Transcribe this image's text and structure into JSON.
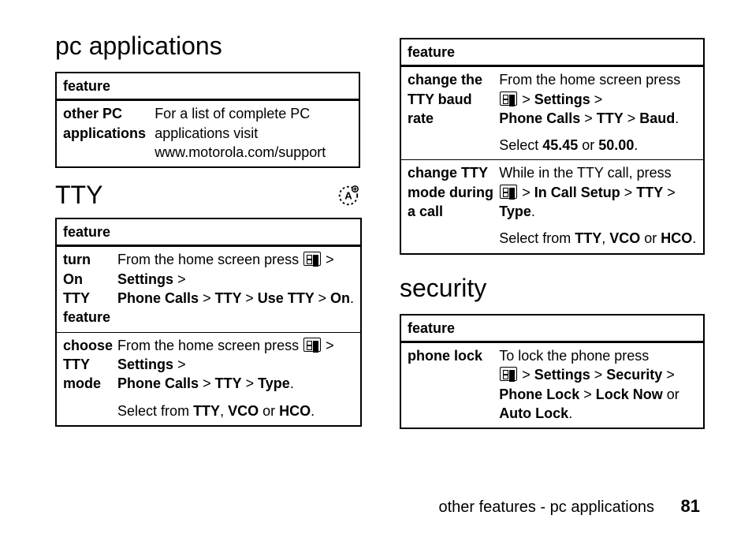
{
  "left": {
    "heading_pc": "pc applications",
    "table_pc": {
      "header": "feature",
      "rows": [
        {
          "name": "other PC applications",
          "desc_plain": "For a list of complete PC applications visit www.motorola.com/support"
        }
      ]
    },
    "heading_tty": "TTY",
    "table_tty": {
      "header": "feature",
      "rows": [
        {
          "name": "turn On TTY feature",
          "desc_pre": "From the home screen press ",
          "path_parts": [
            "Settings",
            "Phone Calls",
            "TTY",
            "Use TTY",
            "On"
          ],
          "desc_post": ""
        },
        {
          "name": "choose TTY mode",
          "desc_pre": "From the home screen press ",
          "path_parts": [
            "Settings",
            "Phone Calls",
            "TTY",
            "Type"
          ],
          "desc_post": "",
          "line2_pre": "Select from ",
          "line2_opts": [
            "TTY",
            "VCO",
            "HCO"
          ]
        }
      ]
    }
  },
  "right": {
    "table_tty2": {
      "header": "feature",
      "rows": [
        {
          "name": "change the TTY baud rate",
          "desc_pre": "From the home screen press ",
          "path_parts": [
            "Settings",
            "Phone Calls",
            "TTY",
            "Baud"
          ],
          "line2_pre": "Select ",
          "line2_opts": [
            "45.45",
            "50.00"
          ],
          "line2_join": " or "
        },
        {
          "name": "change TTY mode during a call",
          "desc_pre": "While in the TTY call, press ",
          "path_parts": [
            "In Call Setup",
            "TTY",
            "Type"
          ],
          "line2_pre": "Select from ",
          "line2_opts": [
            "TTY",
            "VCO",
            "HCO"
          ]
        }
      ]
    },
    "heading_security": "security",
    "table_security": {
      "header": "feature",
      "rows": [
        {
          "name": "phone lock",
          "desc_pre": "To lock the phone press ",
          "path_parts": [
            "Settings",
            "Security",
            "Phone Lock",
            "Lock Now"
          ],
          "tail": " or ",
          "tail_bold": "Auto Lock",
          "tail_end": "."
        }
      ]
    }
  },
  "footer": {
    "text": "other features - pc applications",
    "page": "81"
  }
}
